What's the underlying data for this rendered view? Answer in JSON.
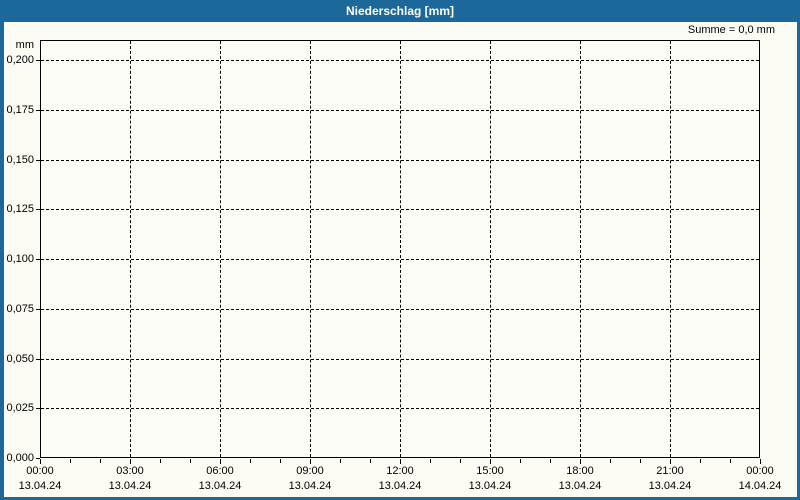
{
  "window": {
    "title": "Niederschlag [mm]"
  },
  "header": {
    "summary": "Summe = 0,0 mm"
  },
  "chart_data": {
    "type": "line",
    "title": "Niederschlag [mm]",
    "ylabel": "mm",
    "xlabel": "",
    "ylim": [
      0,
      0.21
    ],
    "x_range_hours": [
      0,
      24
    ],
    "x_minor_tick_hours": 1,
    "yticks": [
      {
        "value": 0.0,
        "label": "0,000"
      },
      {
        "value": 0.025,
        "label": "0,025"
      },
      {
        "value": 0.05,
        "label": "0,050"
      },
      {
        "value": 0.075,
        "label": "0,075"
      },
      {
        "value": 0.1,
        "label": "0,100"
      },
      {
        "value": 0.125,
        "label": "0,125"
      },
      {
        "value": 0.15,
        "label": "0,150"
      },
      {
        "value": 0.175,
        "label": "0,175"
      },
      {
        "value": 0.2,
        "label": "0,200"
      }
    ],
    "xticks": [
      {
        "hour": 0,
        "time": "00:00",
        "date": "13.04.24"
      },
      {
        "hour": 3,
        "time": "03:00",
        "date": "13.04.24"
      },
      {
        "hour": 6,
        "time": "06:00",
        "date": "13.04.24"
      },
      {
        "hour": 9,
        "time": "09:00",
        "date": "13.04.24"
      },
      {
        "hour": 12,
        "time": "12:00",
        "date": "13.04.24"
      },
      {
        "hour": 15,
        "time": "15:00",
        "date": "13.04.24"
      },
      {
        "hour": 18,
        "time": "18:00",
        "date": "13.04.24"
      },
      {
        "hour": 21,
        "time": "21:00",
        "date": "13.04.24"
      },
      {
        "hour": 24,
        "time": "00:00",
        "date": "14.04.24"
      }
    ],
    "series": [],
    "annotations": [
      "Summe = 0,0 mm"
    ],
    "grid": {
      "show": true,
      "style": "dashed",
      "color": "#000000"
    }
  },
  "colors": {
    "titlebar": "#1d689b",
    "titlebar_text": "#ffffff",
    "background": "#fcfcf5",
    "plot_background": "#fdfdf8",
    "axis": "#000000",
    "text": "#000000"
  }
}
